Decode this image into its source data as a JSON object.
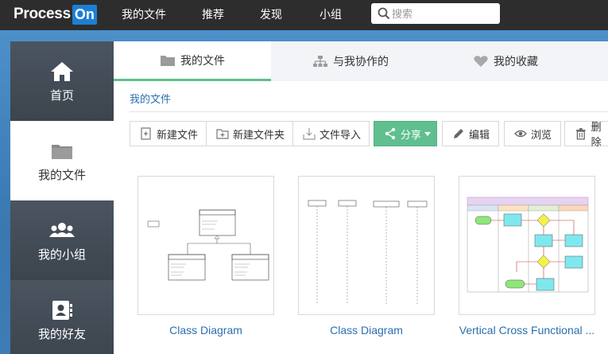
{
  "header": {
    "logo_main": "Process",
    "logo_badge": "On",
    "nav": [
      "我的文件",
      "推荐",
      "发现",
      "小组"
    ],
    "search_placeholder": "搜索"
  },
  "sidebar": {
    "items": [
      {
        "label": "首页",
        "icon": "home-icon"
      },
      {
        "label": "我的文件",
        "icon": "folder-icon"
      },
      {
        "label": "我的小组",
        "icon": "group-icon"
      },
      {
        "label": "我的好友",
        "icon": "contact-card-icon"
      }
    ],
    "active_index": 1
  },
  "tabs": [
    {
      "label": "我的文件",
      "icon": "folder-icon",
      "active": true
    },
    {
      "label": "与我协作的",
      "icon": "hierarchy-icon",
      "active": false
    },
    {
      "label": "我的收藏",
      "icon": "heart-icon",
      "active": false
    }
  ],
  "breadcrumb": "我的文件",
  "toolbar": {
    "new_file": "新建文件",
    "new_folder": "新建文件夹",
    "import": "文件导入",
    "share": "分享",
    "edit": "编辑",
    "browse": "浏览",
    "delete": "删除"
  },
  "files": [
    {
      "title": "Class Diagram"
    },
    {
      "title": "Class Diagram"
    },
    {
      "title": "Vertical Cross Functional ..."
    }
  ],
  "colors": {
    "topbar": "#2d2d2d",
    "accent_blue": "#2a6fb0",
    "logo_badge": "#1d7fd3",
    "share_green": "#5fbf8e",
    "band_blue": "#3e7cb5"
  }
}
